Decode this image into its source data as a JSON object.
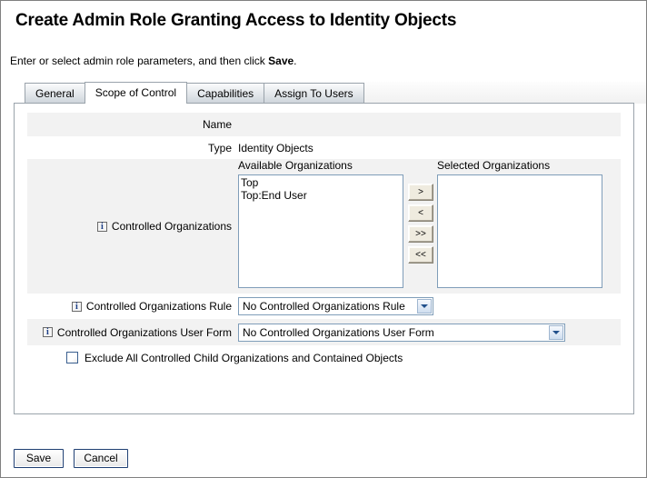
{
  "page": {
    "title": "Create Admin Role Granting Access to Identity Objects",
    "instruction_prefix": "Enter or select admin role parameters, and then click ",
    "instruction_bold": "Save",
    "instruction_suffix": "."
  },
  "tabs": [
    {
      "label": "General",
      "active": false
    },
    {
      "label": "Scope of Control",
      "active": true
    },
    {
      "label": "Capabilities",
      "active": false
    },
    {
      "label": "Assign To Users",
      "active": false
    }
  ],
  "form": {
    "name_row": {
      "label": "Name",
      "value": ""
    },
    "type_row": {
      "label": "Type",
      "value": "Identity Objects"
    },
    "controlled_organizations": {
      "label": "Controlled Organizations",
      "info_icon": "info-icon",
      "available_caption": "Available Organizations",
      "available_options": [
        "Top",
        "Top:End User"
      ],
      "selected_caption": "Selected Organizations",
      "selected_options": [],
      "transfer_buttons": [
        {
          "label": ">",
          "name": "move-right-button"
        },
        {
          "label": "<",
          "name": "move-left-button"
        },
        {
          "label": ">>",
          "name": "move-all-right-button"
        },
        {
          "label": "<<",
          "name": "move-all-left-button"
        }
      ]
    },
    "controlled_organizations_rule": {
      "label": "Controlled Organizations Rule",
      "info_icon": "info-icon",
      "selected_value": "No Controlled Organizations Rule"
    },
    "controlled_organizations_user_form": {
      "label": "Controlled Organizations User Form",
      "info_icon": "info-icon",
      "selected_value": "No Controlled Organizations User Form"
    },
    "exclude_checkbox": {
      "label": "Exclude All Controlled Child Organizations and Contained Objects",
      "checked": false
    }
  },
  "footer": {
    "save_label": "Save",
    "cancel_label": "Cancel"
  },
  "colors": {
    "panel_border": "#9aa3ab",
    "row_shade": "#f2f2f2",
    "field_border": "#7f9db9",
    "button_border": "#1f3f73",
    "info_blue": "#1b3d86"
  }
}
